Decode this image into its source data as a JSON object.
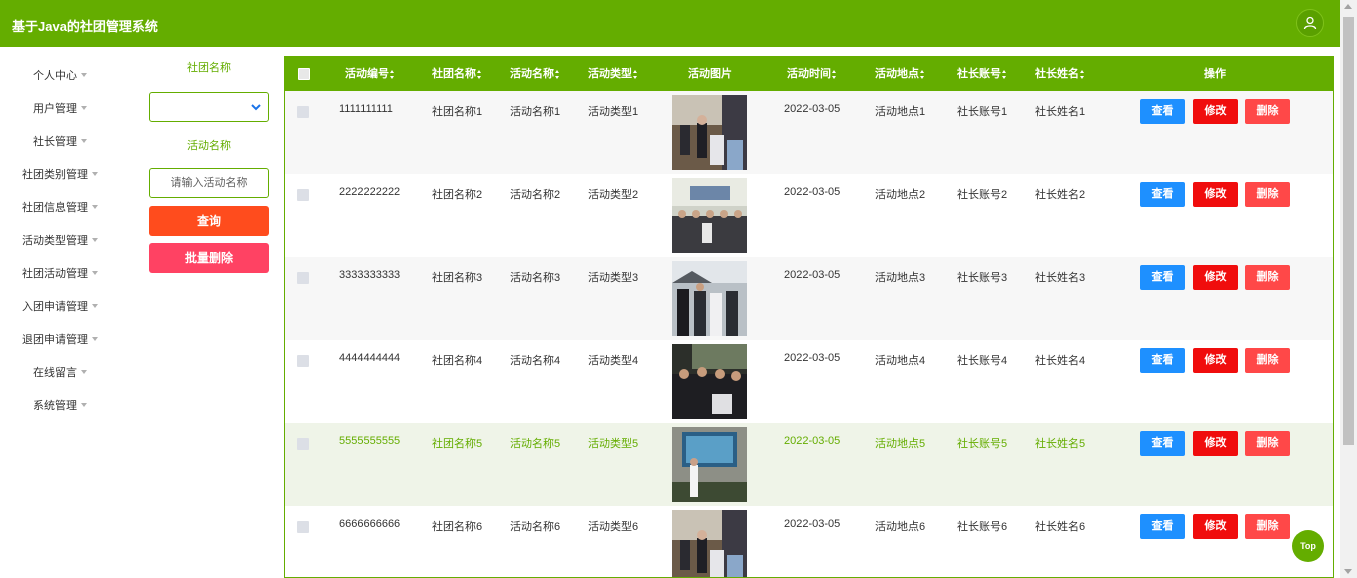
{
  "app": {
    "title": "基于Java的社团管理系统"
  },
  "sidebar": {
    "items": [
      {
        "label": "个人中心"
      },
      {
        "label": "用户管理"
      },
      {
        "label": "社长管理"
      },
      {
        "label": "社团类别管理"
      },
      {
        "label": "社团信息管理"
      },
      {
        "label": "活动类型管理"
      },
      {
        "label": "社团活动管理"
      },
      {
        "label": "入团申请管理"
      },
      {
        "label": "退团申请管理"
      },
      {
        "label": "在线留言"
      },
      {
        "label": "系统管理"
      }
    ]
  },
  "filter": {
    "club_name_label": "社团名称",
    "club_select_value": "",
    "activity_name_label": "活动名称",
    "activity_name_placeholder": "请输入活动名称",
    "search_button": "查询",
    "bulk_delete_button": "批量删除"
  },
  "table": {
    "columns": [
      "活动编号",
      "社团名称",
      "活动名称",
      "活动类型",
      "活动图片",
      "活动时间",
      "活动地点",
      "社长账号",
      "社长姓名",
      "操作"
    ],
    "action_labels": {
      "view": "查看",
      "edit": "修改",
      "delete": "删除"
    },
    "rows": [
      {
        "id": "1111111111",
        "club": "社团名称1",
        "activity": "活动名称1",
        "type": "活动类型1",
        "time": "2022-03-05",
        "location": "活动地点1",
        "account": "社长账号1",
        "leader": "社长姓名1"
      },
      {
        "id": "2222222222",
        "club": "社团名称2",
        "activity": "活动名称2",
        "type": "活动类型2",
        "time": "2022-03-05",
        "location": "活动地点2",
        "account": "社长账号2",
        "leader": "社长姓名2"
      },
      {
        "id": "3333333333",
        "club": "社团名称3",
        "activity": "活动名称3",
        "type": "活动类型3",
        "time": "2022-03-05",
        "location": "活动地点3",
        "account": "社长账号3",
        "leader": "社长姓名3"
      },
      {
        "id": "4444444444",
        "club": "社团名称4",
        "activity": "活动名称4",
        "type": "活动类型4",
        "time": "2022-03-05",
        "location": "活动地点4",
        "account": "社长账号4",
        "leader": "社长姓名4"
      },
      {
        "id": "5555555555",
        "club": "社团名称5",
        "activity": "活动名称5",
        "type": "活动类型5",
        "time": "2022-03-05",
        "location": "活动地点5",
        "account": "社长账号5",
        "leader": "社长姓名5"
      },
      {
        "id": "6666666666",
        "club": "社团名称6",
        "activity": "活动名称6",
        "type": "活动类型6",
        "time": "2022-03-05",
        "location": "活动地点6",
        "account": "社长账号6",
        "leader": "社长姓名6"
      }
    ]
  },
  "back_to_top": "Top",
  "colors": {
    "primary": "#64ad00",
    "view": "#1e90ff",
    "edit": "#f00d0d",
    "delete": "#ff4848",
    "search": "#ff4c1d",
    "bulk_delete": "#ff4263"
  }
}
